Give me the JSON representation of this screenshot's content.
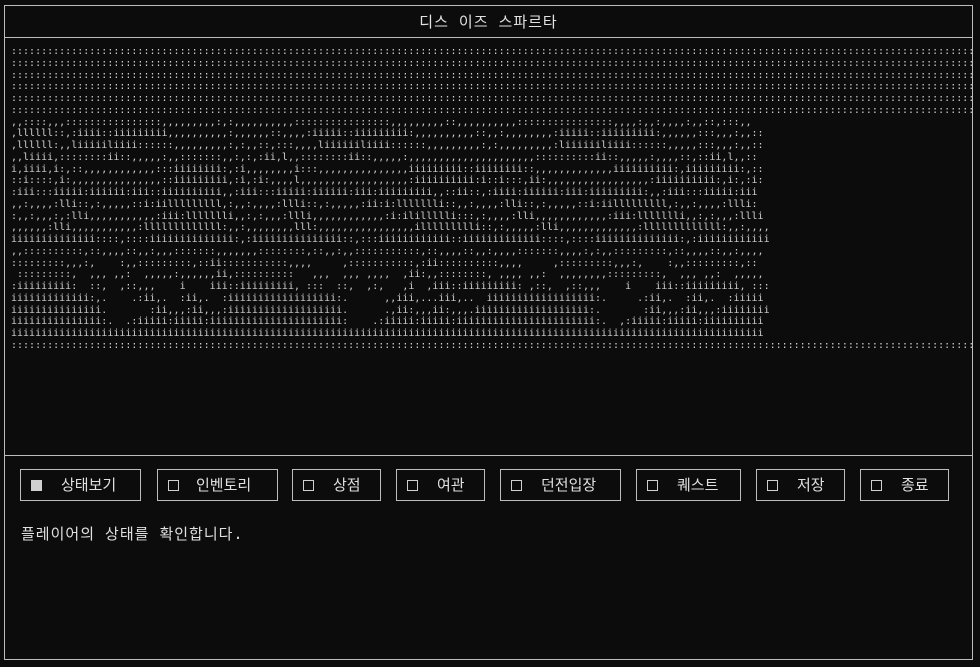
{
  "window": {
    "title": "디스 이즈 스파르타"
  },
  "menu": {
    "items": [
      {
        "label": "상태보기",
        "checked": true
      },
      {
        "label": "인벤토리",
        "checked": false
      },
      {
        "label": "상점",
        "checked": false
      },
      {
        "label": "여관",
        "checked": false
      },
      {
        "label": "던전입장",
        "checked": false
      },
      {
        "label": "퀘스트",
        "checked": false
      },
      {
        "label": "저장",
        "checked": false
      },
      {
        "label": "종료",
        "checked": false
      }
    ]
  },
  "status": {
    "message": "플레이어의 상태를 확인합니다."
  },
  "colors": {
    "background": "#0c0c0c",
    "border": "#bdbdbd",
    "text": "#e0e0e0"
  }
}
